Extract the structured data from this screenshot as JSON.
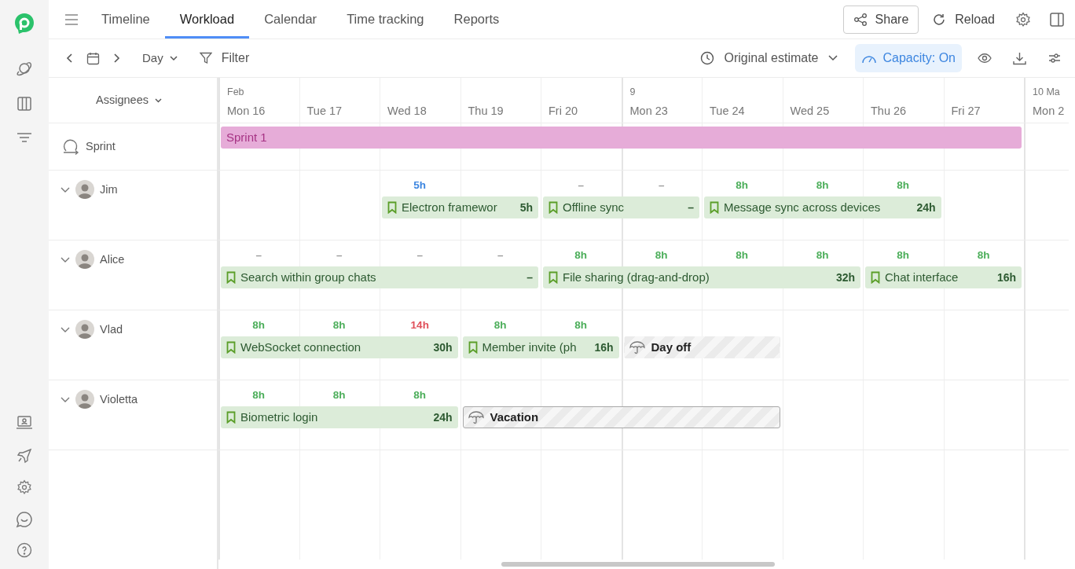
{
  "tabs": [
    {
      "label": "Timeline",
      "selected": false
    },
    {
      "label": "Workload",
      "selected": true
    },
    {
      "label": "Calendar",
      "selected": false
    },
    {
      "label": "Time tracking",
      "selected": false
    },
    {
      "label": "Reports",
      "selected": false
    }
  ],
  "header_actions": {
    "share": "Share",
    "reload": "Reload"
  },
  "toolbar": {
    "scale": "Day",
    "filter": "Filter",
    "estimate": "Original estimate",
    "capacity": {
      "label": "Capacity: On",
      "on": true
    }
  },
  "assignees_header": "Assignees",
  "days": [
    {
      "month": "Feb",
      "label": "Mon 16",
      "week_start": true
    },
    {
      "label": "Tue 17",
      "week_start": false
    },
    {
      "label": "Wed 18",
      "week_start": false
    },
    {
      "label": "Thu 19",
      "week_start": false
    },
    {
      "label": "Fri 20",
      "week_start": false
    },
    {
      "month": "9",
      "label": "Mon 23",
      "week_start": true
    },
    {
      "label": "Tue 24",
      "week_start": false
    },
    {
      "label": "Wed 25",
      "week_start": false
    },
    {
      "label": "Thu 26",
      "week_start": false
    },
    {
      "label": "Fri 27",
      "week_start": false
    },
    {
      "month": "10 Ma",
      "label": "Mon 2",
      "week_start": true
    }
  ],
  "sprint": {
    "label": "Sprint",
    "bar": "Sprint 1"
  },
  "people": [
    {
      "name": "Jim",
      "expanded": true,
      "segments": [
        {
          "kind": "gap"
        },
        {
          "kind": "gap"
        },
        {
          "kind": "task",
          "label": "Electron framewor",
          "hours": "5h",
          "days": [
            {
              "kind": "load",
              "load": "5h",
              "color": "#3d86e0"
            },
            {
              "kind": "gap"
            }
          ]
        },
        {
          "kind": "task",
          "label": "Offline sync",
          "hours": "–",
          "days": [
            {
              "kind": "load",
              "load": "–",
              "color": "#999999"
            },
            {
              "kind": "load",
              "load": "–",
              "color": "#999999"
            }
          ]
        },
        {
          "kind": "task",
          "label": "Message sync across devices",
          "hours": "24h",
          "days": [
            {
              "kind": "load",
              "load": "8h",
              "color": "#4cae5a"
            },
            {
              "kind": "load",
              "load": "8h",
              "color": "#4cae5a"
            },
            {
              "kind": "load",
              "load": "8h",
              "color": "#4cae5a"
            }
          ]
        }
      ]
    },
    {
      "name": "Alice",
      "expanded": true,
      "segments": [
        {
          "kind": "task",
          "label": "Search within group chats",
          "hours": "–",
          "days": [
            {
              "kind": "load",
              "load": "–",
              "color": "#999999"
            },
            {
              "kind": "load",
              "load": "–",
              "color": "#999999"
            },
            {
              "kind": "load",
              "load": "–",
              "color": "#999999"
            },
            {
              "kind": "load",
              "load": "–",
              "color": "#999999"
            }
          ]
        },
        {
          "kind": "task",
          "label": "File sharing (drag-and-drop)",
          "hours": "32h",
          "days": [
            {
              "kind": "load",
              "load": "8h",
              "color": "#4cae5a"
            },
            {
              "kind": "load",
              "load": "8h",
              "color": "#4cae5a"
            },
            {
              "kind": "load",
              "load": "8h",
              "color": "#4cae5a"
            },
            {
              "kind": "load",
              "load": "8h",
              "color": "#4cae5a"
            }
          ]
        },
        {
          "kind": "task",
          "label": "Chat interface",
          "hours": "16h",
          "days": [
            {
              "kind": "load",
              "load": "8h",
              "color": "#4cae5a"
            },
            {
              "kind": "load",
              "load": "8h",
              "color": "#4cae5a"
            }
          ]
        }
      ]
    },
    {
      "name": "Vlad",
      "expanded": true,
      "segments": [
        {
          "kind": "task",
          "label": "WebSocket connection",
          "hours": "30h",
          "days": [
            {
              "kind": "load",
              "load": "8h",
              "color": "#4cae5a"
            },
            {
              "kind": "load",
              "load": "8h",
              "color": "#4cae5a"
            },
            {
              "kind": "load",
              "load": "14h",
              "color": "#e0505a"
            }
          ]
        },
        {
          "kind": "task",
          "label": "Member invite (ph",
          "hours": "16h",
          "days": [
            {
              "kind": "load",
              "load": "8h",
              "color": "#4cae5a"
            },
            {
              "kind": "load",
              "load": "8h",
              "color": "#4cae5a"
            }
          ]
        },
        {
          "kind": "timeoff",
          "label": "Day off",
          "selected": false,
          "days": [
            {
              "kind": "gap"
            },
            {
              "kind": "gap"
            }
          ]
        }
      ]
    },
    {
      "name": "Violetta",
      "expanded": true,
      "segments": [
        {
          "kind": "task",
          "label": "Biometric login",
          "hours": "24h",
          "days": [
            {
              "kind": "load",
              "load": "8h",
              "color": "#4cae5a"
            },
            {
              "kind": "load",
              "load": "8h",
              "color": "#4cae5a"
            },
            {
              "kind": "load",
              "load": "8h",
              "color": "#4cae5a"
            }
          ]
        },
        {
          "kind": "timeoff",
          "label": "Vacation",
          "selected": true,
          "days": [
            {
              "kind": "gap"
            },
            {
              "kind": "gap"
            },
            {
              "kind": "gap"
            },
            {
              "kind": "gap"
            }
          ]
        }
      ]
    }
  ]
}
